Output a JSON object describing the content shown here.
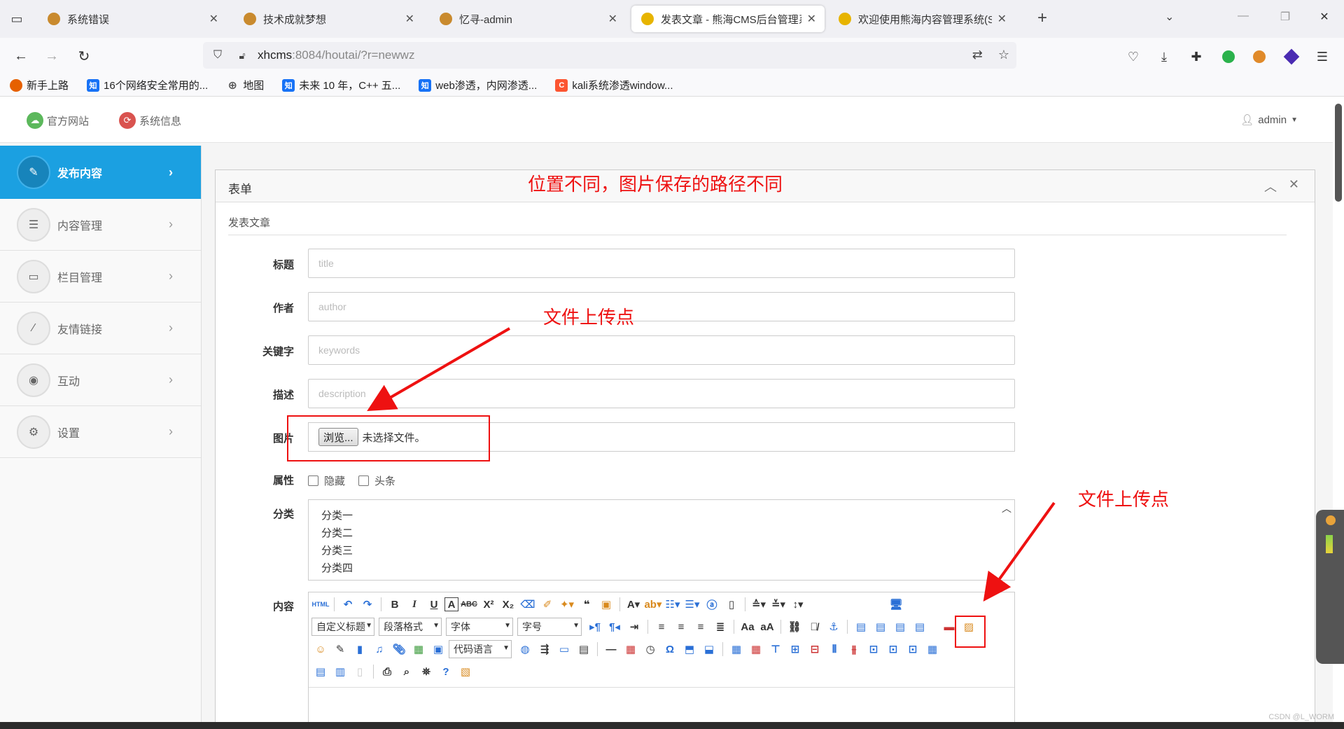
{
  "browser": {
    "tabs": [
      {
        "label": "系统错误",
        "active": false
      },
      {
        "label": "技术成就梦想",
        "active": false
      },
      {
        "label": "忆寻-admin",
        "active": false
      },
      {
        "label": "发表文章 - 熊海CMS后台管理系",
        "active": true
      },
      {
        "label": "欢迎使用熊海内容管理系统(SE/",
        "active": false
      }
    ],
    "url_host": "xhcms",
    "url_rest": ":8084/houtai/?r=newwz",
    "bookmarks": [
      {
        "label": "新手上路",
        "icon": "firefox-icon",
        "color": "#e66000"
      },
      {
        "label": "16个网络安全常用的...",
        "icon": "zhihu-icon",
        "color": "#1772f6"
      },
      {
        "label": "地图",
        "icon": "globe-icon",
        "color": "#555555"
      },
      {
        "label": "未来 10 年，C++ 五...",
        "icon": "zhihu-icon",
        "color": "#1772f6"
      },
      {
        "label": "web渗透，内网渗透...",
        "icon": "zhihu-icon",
        "color": "#1772f6"
      },
      {
        "label": "kali系统渗透window...",
        "icon": "csdn-icon",
        "color": "#fc5531"
      }
    ]
  },
  "topbar": {
    "official_site": "官方网站",
    "system_info": "系统信息",
    "user": "admin"
  },
  "sidebar": {
    "items": [
      {
        "label": "发布内容",
        "icon": "pencil-icon",
        "active": true
      },
      {
        "label": "内容管理",
        "icon": "list-icon",
        "active": false
      },
      {
        "label": "栏目管理",
        "icon": "window-icon",
        "active": false
      },
      {
        "label": "友情链接",
        "icon": "magic-wand-icon",
        "active": false
      },
      {
        "label": "互动",
        "icon": "comments-icon",
        "active": false
      },
      {
        "label": "设置",
        "icon": "gears-icon",
        "active": false
      }
    ]
  },
  "panel": {
    "title": "表单",
    "subtitle": "发表文章",
    "annotation_top": "位置不同，图片保存的路径不同",
    "annotation_upload1": "文件上传点",
    "annotation_upload2": "文件上传点"
  },
  "form": {
    "title_label": "标题",
    "title_placeholder": "title",
    "author_label": "作者",
    "author_placeholder": "author",
    "keywords_label": "关键字",
    "keywords_placeholder": "keywords",
    "desc_label": "描述",
    "desc_placeholder": "description",
    "image_label": "图片",
    "browse_button": "浏览...",
    "file_status": "未选择文件。",
    "attr_label": "属性",
    "attr_hidden": "隐藏",
    "attr_headline": "头条",
    "category_label": "分类",
    "categories": [
      "分类一",
      "分类二",
      "分类三",
      "分类四"
    ],
    "content_label": "内容"
  },
  "editor": {
    "custom_heading": "自定义标题",
    "paragraph_format": "段落格式",
    "font_family": "字体",
    "font_size": "字号",
    "code_language": "代码语言"
  },
  "watermark": "CSDN @L_WORM"
}
